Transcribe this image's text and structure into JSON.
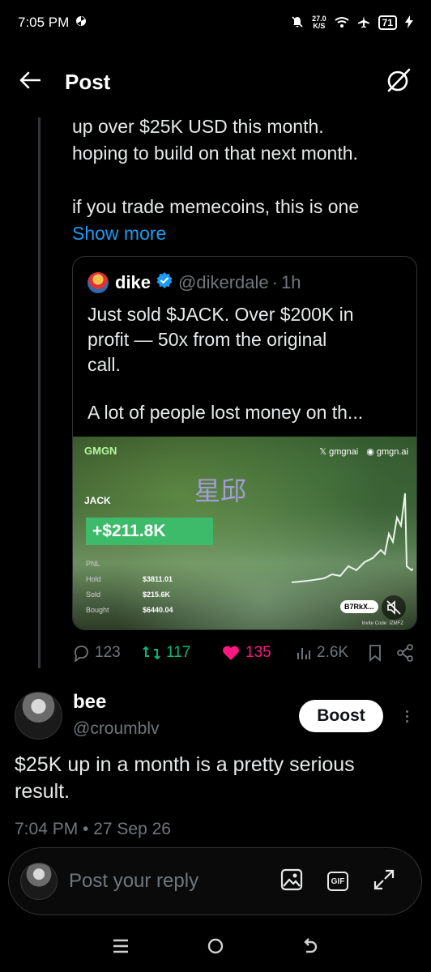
{
  "status_bar": {
    "time": "7:05 PM",
    "net_speed_value": "27.0",
    "net_speed_unit": "K/S",
    "battery": "71"
  },
  "header": {
    "title": "Post"
  },
  "post": {
    "text_line1": "up over $25K USD this month.",
    "text_line2": "hoping to build on that next month.",
    "text_line3": "if you trade memecoins, this is one",
    "show_more": "Show more"
  },
  "quote": {
    "name": "dike",
    "handle": "@dikerdale",
    "separator": "·",
    "time": "1h",
    "text_line1": "Just sold $JACK. Over $200K in",
    "text_line2": "profit — 50x from the original",
    "text_line3": "call.",
    "text_line4": "A lot of people lost money on th...",
    "image": {
      "logo": "GMGN",
      "brand_x": "gmgnai",
      "brand_site": "gmgn.ai",
      "token": "JACK",
      "overlay_text": "星邱",
      "pnl_value": "+$211.8K",
      "stats": [
        {
          "label": "PNL",
          "value": ""
        },
        {
          "label": "Hold",
          "value": "$3811.01"
        },
        {
          "label": "Sold",
          "value": "$215.6K"
        },
        {
          "label": "Bought",
          "value": "$6440.04"
        }
      ],
      "pill": "B7RkX...",
      "invite": "Invite Code: IZMFZ"
    }
  },
  "actions": {
    "replies": "123",
    "reposts": "117",
    "likes": "135",
    "views": "2.6K"
  },
  "reply": {
    "name": "bee",
    "handle": "@croumblv",
    "boost_label": "Boost",
    "text_line1": "$25K up in a month is a pretty serious",
    "text_line2": "result.",
    "timestamp": "7:04 PM • 27 Sep 26"
  },
  "composer": {
    "placeholder": "Post your reply"
  },
  "colors": {
    "accent": "#1d9bf0",
    "repost": "#00ba7c",
    "like": "#f91880",
    "muted": "#71767b",
    "pnl_green": "#3dbb6a"
  }
}
